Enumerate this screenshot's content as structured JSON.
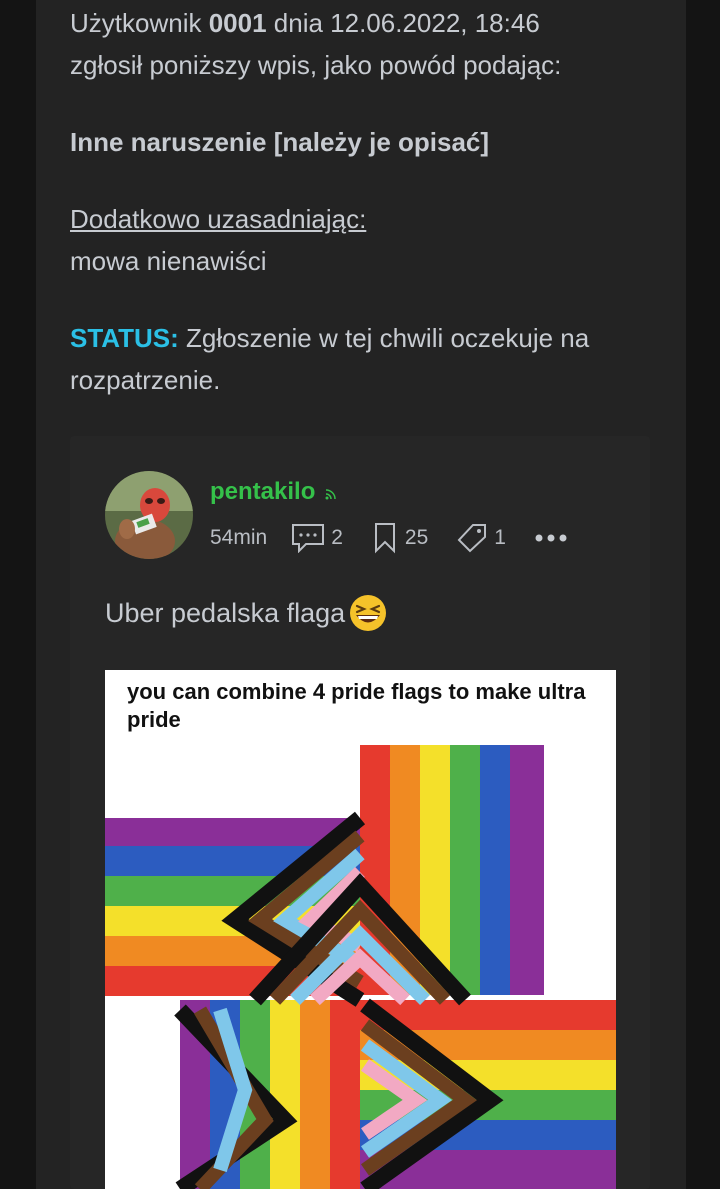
{
  "report": {
    "line1_prefix": "Użytkownik ",
    "user_id": "0001",
    "line1_suffix": " dnia 12.06.2022, 18:46",
    "line2": "zgłosił poniższy wpis, jako powód podając:",
    "reason": "Inne naruszenie [należy je opisać]",
    "extra_label": "Dodatkowo uzasadniając:",
    "extra_text": "mowa nienawiści",
    "status_key": "STATUS:",
    "status_text": " Zgłoszenie w tej chwili oczekuje na rozpatrzenie."
  },
  "post": {
    "author": "pentakilo",
    "time": "54min",
    "comments": "2",
    "bookmarks": "25",
    "tags": "1",
    "text": "Uber pedalska flaga",
    "image_caption": "you can combine 4 pride flags to make ultra pride"
  },
  "colors": {
    "background": "#141414",
    "panel": "#232323",
    "accent_status": "#2bc0e6",
    "author": "#35c14a"
  },
  "icons": [
    "rss-icon",
    "comment-icon",
    "bookmark-icon",
    "tag-icon",
    "more-icon",
    "grinning-squinting-emoji"
  ]
}
